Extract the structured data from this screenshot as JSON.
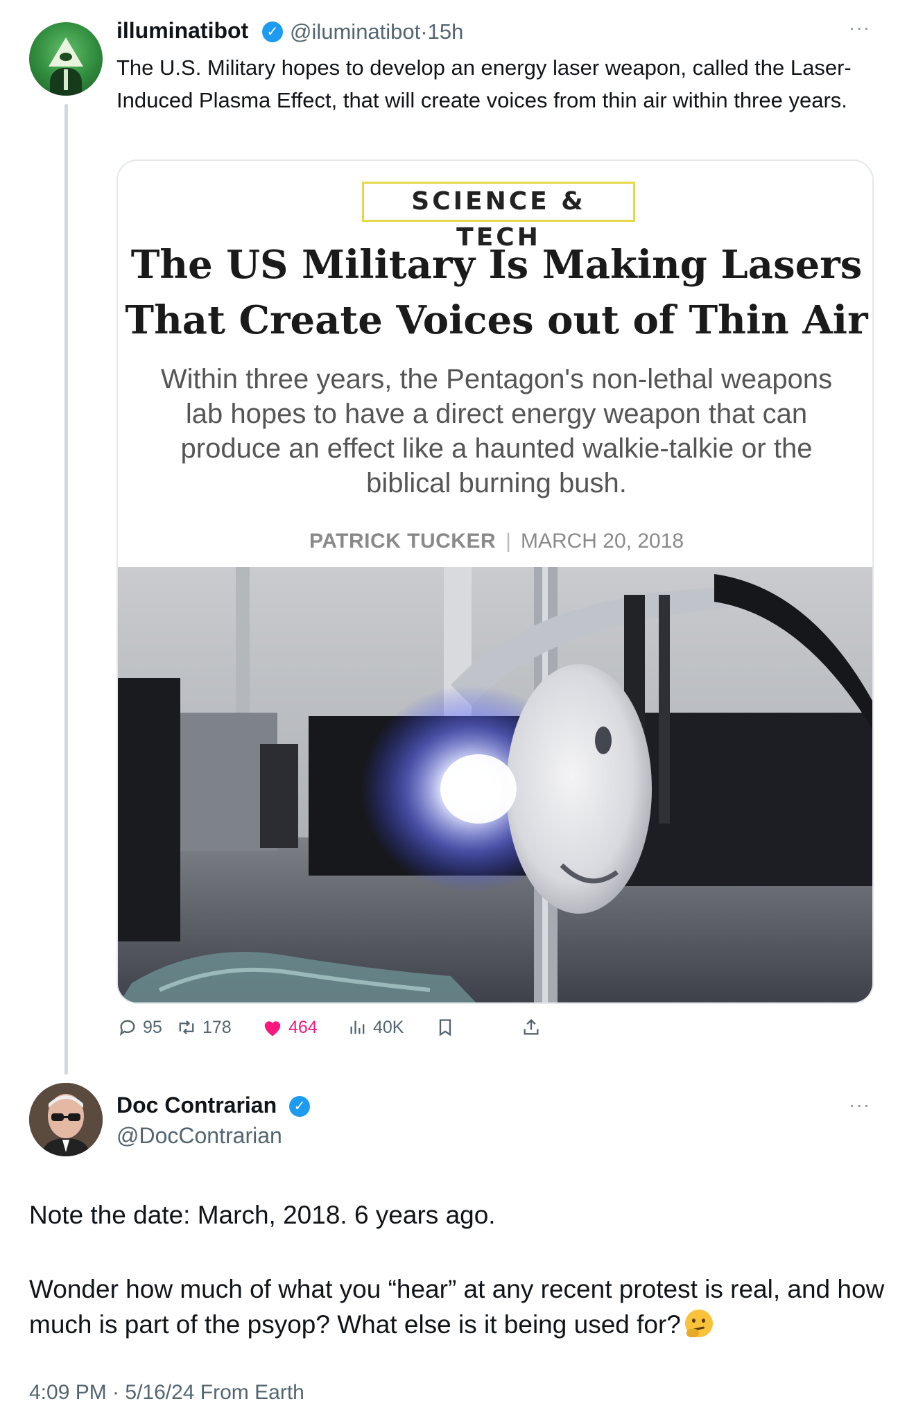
{
  "tweet1": {
    "display_name": "illuminatibot",
    "handle": "@iluminatibot",
    "separator": "·",
    "time": "15h",
    "more": "···",
    "text": "The U.S. Military hopes to develop an energy laser weapon, called the Laser-Induced Plasma Effect, that will create voices from thin air within three years.",
    "card": {
      "section": "SCIENCE & TECH",
      "headline": "The US Military Is Making Lasers That Create Voices out of Thin Air",
      "subhead": "Within three years, the Pentagon's non-lethal weapons lab hopes to have a direct energy weapon that can produce an effect like a haunted walkie-talkie or the biblical burning bush.",
      "author": "PATRICK TUCKER",
      "byline_separator": "|",
      "date": "MARCH 20, 2018"
    },
    "actions": {
      "replies": "95",
      "reposts": "178",
      "likes": "464",
      "views": "40K"
    }
  },
  "tweet2": {
    "display_name": "Doc Contrarian",
    "handle": "@DocContrarian",
    "more": "···",
    "line1": "Note the date: March, 2018. 6 years ago.",
    "para2": "Wonder how much of what you “hear” at any recent protest is real, and how much is part of the psyop? What else is it being used for?",
    "timestamp": "4:09 PM · 5/16/24 From Earth"
  },
  "colors": {
    "verified": "#1d9bf0",
    "like": "#f91880",
    "muted": "#536471",
    "tag_border": "#e6d84a"
  },
  "icons": [
    "reply-icon",
    "repost-icon",
    "like-icon",
    "views-icon",
    "bookmark-icon",
    "share-icon",
    "verified-icon",
    "more-icon"
  ]
}
